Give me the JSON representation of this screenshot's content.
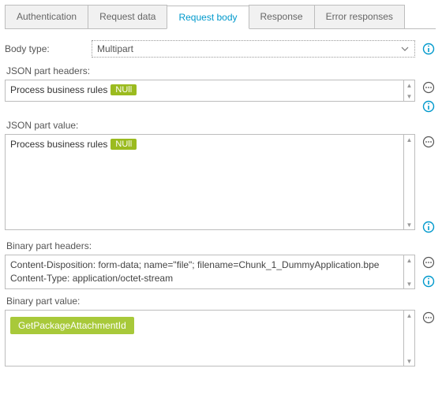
{
  "tabs": {
    "authentication": "Authentication",
    "request_data": "Request data",
    "request_body": "Request body",
    "response": "Response",
    "error_responses": "Error responses"
  },
  "body_type": {
    "label": "Body type:",
    "value": "Multipart"
  },
  "sections": {
    "json_headers_label": "JSON part headers:",
    "json_value_label": "JSON part value:",
    "binary_headers_label": "Binary part headers:",
    "binary_value_label": "Binary part value:"
  },
  "json_headers": {
    "chip_text": "Process business rules",
    "chip_badge": "NUll"
  },
  "json_value": {
    "chip_text": "Process business rules",
    "chip_badge": "NUll"
  },
  "binary_headers": {
    "line1": "Content-Disposition: form-data; name=\"file\"; filename=Chunk_1_DummyApplication.bpe",
    "line2": "Content-Type: application/octet-stream"
  },
  "binary_value": {
    "chip": "GetPackageAttachmentId"
  }
}
